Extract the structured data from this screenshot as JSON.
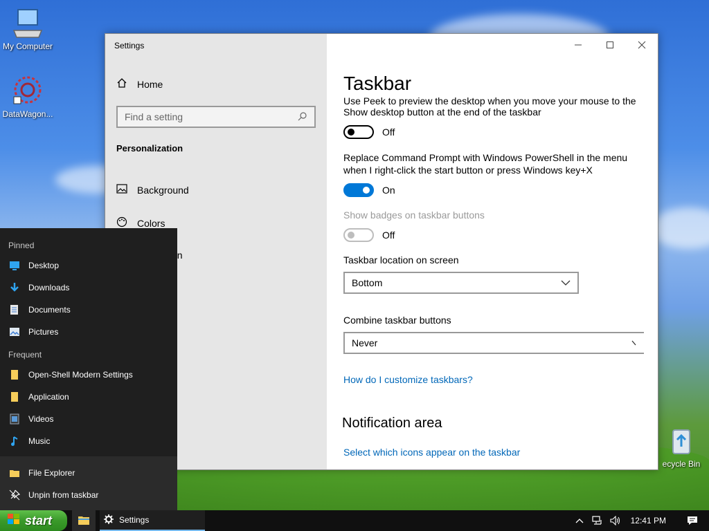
{
  "desktop": {
    "icons": [
      {
        "label": "My Computer",
        "icon": "computer-icon"
      },
      {
        "label": "DataWagon...",
        "icon": "datawagon-icon"
      },
      {
        "label": "ecycle Bin",
        "icon": "recycle-bin-icon"
      }
    ]
  },
  "settings_window": {
    "title": "Settings",
    "nav": {
      "home": "Home",
      "search_placeholder": "Find a setting",
      "section": "Personalization",
      "items": [
        "Background",
        "Colors",
        "en"
      ]
    },
    "content": {
      "title": "Taskbar",
      "clipped_text": "Use Peek to preview the desktop when you move your mouse to the",
      "peek_text_line2": "Show desktop button at the end of the taskbar",
      "peek_toggle": {
        "state": "Off",
        "value": false
      },
      "powershell_text": "Replace Command Prompt with Windows PowerShell in the menu when I right-click the start button or press Windows key+X",
      "powershell_toggle": {
        "state": "On",
        "value": true
      },
      "badges_text": "Show badges on taskbar buttons",
      "badges_toggle": {
        "state": "Off",
        "value": false,
        "disabled": true
      },
      "location_label": "Taskbar location on screen",
      "location_value": "Bottom",
      "combine_label": "Combine taskbar buttons",
      "combine_value": "Never",
      "help_link": "How do I customize taskbars?",
      "notification_heading": "Notification area",
      "notification_link": "Select which icons appear on the taskbar"
    }
  },
  "start_menu": {
    "pinned_label": "Pinned",
    "pinned": [
      "Desktop",
      "Downloads",
      "Documents",
      "Pictures"
    ],
    "frequent_label": "Frequent",
    "frequent": [
      "Open-Shell Modern Settings",
      "Application",
      "Videos",
      "Music"
    ],
    "bottom": [
      "File Explorer",
      "Unpin from taskbar"
    ]
  },
  "taskbar": {
    "start_label": "start",
    "settings_label": "Settings",
    "time": "12:41 PM"
  },
  "colors": {
    "accent": "#0078d7",
    "link": "#0067b8",
    "start_green": "#3a9a2a"
  }
}
